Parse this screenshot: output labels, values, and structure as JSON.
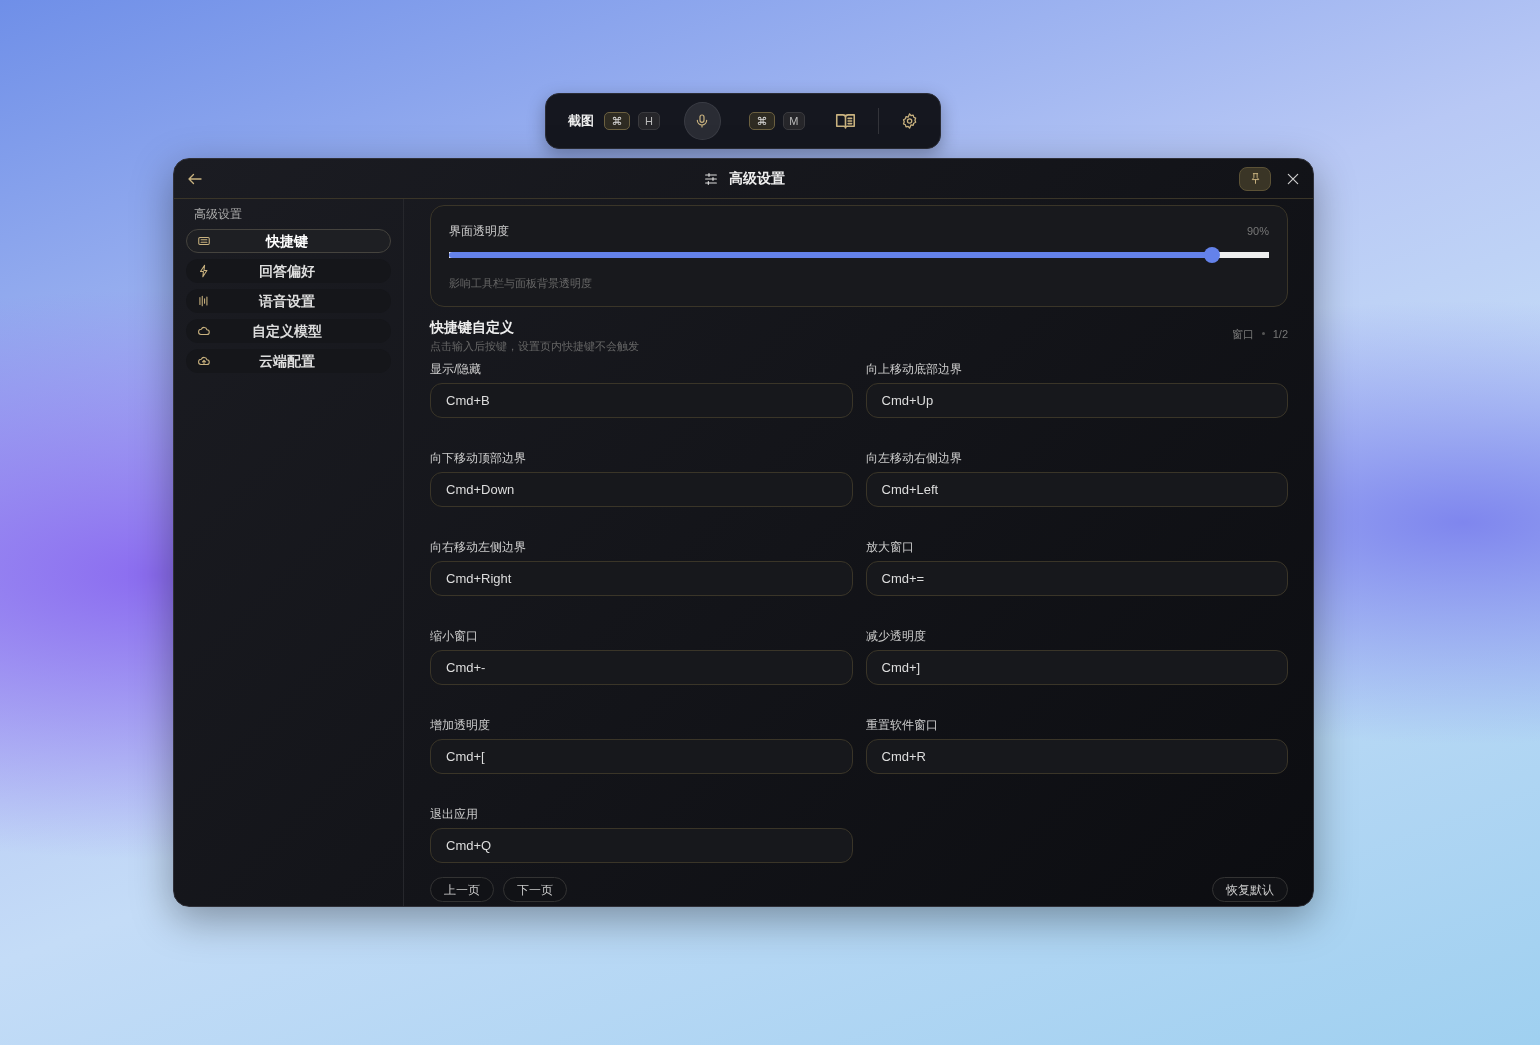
{
  "toolbar": {
    "label": "截图",
    "screenshot_keys": [
      {
        "label": "⌘",
        "kind": "modifier"
      },
      {
        "label": "H",
        "kind": "letter"
      }
    ],
    "voice_keys": [
      {
        "label": "⌘",
        "kind": "modifier"
      },
      {
        "label": "M",
        "kind": "letter"
      }
    ]
  },
  "window": {
    "title": "高级设置",
    "pinned": true
  },
  "sidebar": {
    "heading": "高级设置",
    "items": [
      {
        "label": "快捷键",
        "selected": true
      },
      {
        "label": "回答偏好",
        "selected": false
      },
      {
        "label": "语音设置",
        "selected": false
      },
      {
        "label": "自定义模型",
        "selected": false
      },
      {
        "label": "云端配置",
        "selected": false
      }
    ]
  },
  "opacity": {
    "label": "界面透明度",
    "reading": "90%",
    "level": 0.93,
    "hint": "影响工具栏与面板背景透明度"
  },
  "shortcuts": {
    "title": "快捷键自定义",
    "subtitle": "点击输入后按键，设置页内快捷键不会触发",
    "category": "窗口",
    "page": "1/2",
    "fields": [
      {
        "label": "显示/隐藏",
        "value": "Cmd+B"
      },
      {
        "label": "向上移动底部边界",
        "value": "Cmd+Up"
      },
      {
        "label": "向下移动顶部边界",
        "value": "Cmd+Down"
      },
      {
        "label": "向左移动右侧边界",
        "value": "Cmd+Left"
      },
      {
        "label": "向右移动左侧边界",
        "value": "Cmd+Right"
      },
      {
        "label": "放大窗口",
        "value": "Cmd+="
      },
      {
        "label": "缩小窗口",
        "value": "Cmd+-"
      },
      {
        "label": "减少透明度",
        "value": "Cmd+]"
      },
      {
        "label": "增加透明度",
        "value": "Cmd+["
      },
      {
        "label": "重置软件窗口",
        "value": "Cmd+R"
      },
      {
        "label": "退出应用",
        "value": "Cmd+Q"
      }
    ],
    "prev": "上一页",
    "next": "下一页",
    "reset": "恢复默认"
  }
}
